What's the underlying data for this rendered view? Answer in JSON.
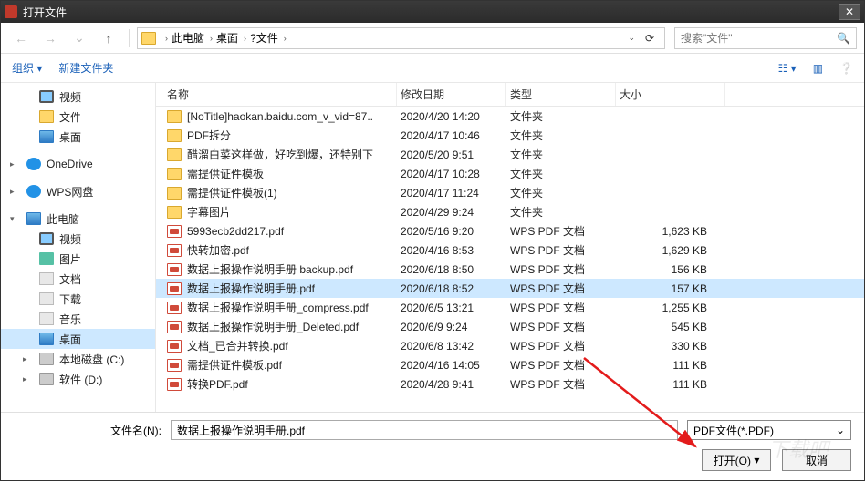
{
  "title": "打开文件",
  "path_segments": [
    "此电脑",
    "桌面",
    "?文件"
  ],
  "search_placeholder": "搜索\"文件\"",
  "toolbar": {
    "organize": "组织",
    "new_folder": "新建文件夹"
  },
  "columns": {
    "name": "名称",
    "modified": "修改日期",
    "type": "类型",
    "size": "大小"
  },
  "sidebar": [
    {
      "icon": "video",
      "label": "视频",
      "indent": 1
    },
    {
      "icon": "folder",
      "label": "文件",
      "indent": 1
    },
    {
      "icon": "desktop",
      "label": "桌面",
      "indent": 1
    },
    {
      "icon": "onedrive",
      "label": "OneDrive",
      "indent": 0,
      "exp": "▸"
    },
    {
      "icon": "wps",
      "label": "WPS网盘",
      "indent": 0,
      "exp": "▸"
    },
    {
      "icon": "pc",
      "label": "此电脑",
      "indent": 0,
      "exp": "▾"
    },
    {
      "icon": "video",
      "label": "视频",
      "indent": 1
    },
    {
      "icon": "pic",
      "label": "图片",
      "indent": 1
    },
    {
      "icon": "doc",
      "label": "文档",
      "indent": 1
    },
    {
      "icon": "dl",
      "label": "下载",
      "indent": 1
    },
    {
      "icon": "music",
      "label": "音乐",
      "indent": 1
    },
    {
      "icon": "desktop",
      "label": "桌面",
      "indent": 1,
      "selected": true
    },
    {
      "icon": "disk",
      "label": "本地磁盘 (C:)",
      "indent": 1,
      "exp": "▸"
    },
    {
      "icon": "disk",
      "label": "软件 (D:)",
      "indent": 1,
      "exp": "▸"
    }
  ],
  "files": [
    {
      "icon": "folder",
      "name": "[NoTitle]haokan.baidu.com_v_vid=87..",
      "date": "2020/4/20 14:20",
      "type": "文件夹",
      "size": ""
    },
    {
      "icon": "folder",
      "name": "PDF拆分",
      "date": "2020/4/17 10:46",
      "type": "文件夹",
      "size": ""
    },
    {
      "icon": "folder",
      "name": "醋溜白菜这样做，好吃到爆，还特别下",
      "date": "2020/5/20 9:51",
      "type": "文件夹",
      "size": ""
    },
    {
      "icon": "folder",
      "name": "需提供证件模板",
      "date": "2020/4/17 10:28",
      "type": "文件夹",
      "size": ""
    },
    {
      "icon": "folder",
      "name": "需提供证件模板(1)",
      "date": "2020/4/17 11:24",
      "type": "文件夹",
      "size": ""
    },
    {
      "icon": "folder",
      "name": "字幕图片",
      "date": "2020/4/29 9:24",
      "type": "文件夹",
      "size": ""
    },
    {
      "icon": "pdf",
      "name": "5993ecb2dd217.pdf",
      "date": "2020/5/16 9:20",
      "type": "WPS PDF 文档",
      "size": "1,623 KB"
    },
    {
      "icon": "pdf",
      "name": "快转加密.pdf",
      "date": "2020/4/16 8:53",
      "type": "WPS PDF 文档",
      "size": "1,629 KB"
    },
    {
      "icon": "pdf",
      "name": "数据上报操作说明手册 backup.pdf",
      "date": "2020/6/18 8:50",
      "type": "WPS PDF 文档",
      "size": "156 KB"
    },
    {
      "icon": "pdf",
      "name": "数据上报操作说明手册.pdf",
      "date": "2020/6/18 8:52",
      "type": "WPS PDF 文档",
      "size": "157 KB",
      "selected": true
    },
    {
      "icon": "pdf",
      "name": "数据上报操作说明手册_compress.pdf",
      "date": "2020/6/5 13:21",
      "type": "WPS PDF 文档",
      "size": "1,255 KB"
    },
    {
      "icon": "pdf",
      "name": "数据上报操作说明手册_Deleted.pdf",
      "date": "2020/6/9 9:24",
      "type": "WPS PDF 文档",
      "size": "545 KB"
    },
    {
      "icon": "pdf",
      "name": "文档_已合并转换.pdf",
      "date": "2020/6/8 13:42",
      "type": "WPS PDF 文档",
      "size": "330 KB"
    },
    {
      "icon": "pdf",
      "name": "需提供证件模板.pdf",
      "date": "2020/4/16 14:05",
      "type": "WPS PDF 文档",
      "size": "111 KB"
    },
    {
      "icon": "pdf",
      "name": "转换PDF.pdf",
      "date": "2020/4/28 9:41",
      "type": "WPS PDF 文档",
      "size": "111 KB"
    }
  ],
  "filename_label": "文件名(N):",
  "filename_value": "数据上报操作说明手册.pdf",
  "filter_label": "PDF文件(*.PDF)",
  "open_btn": "打开(O)",
  "cancel_btn": "取消"
}
